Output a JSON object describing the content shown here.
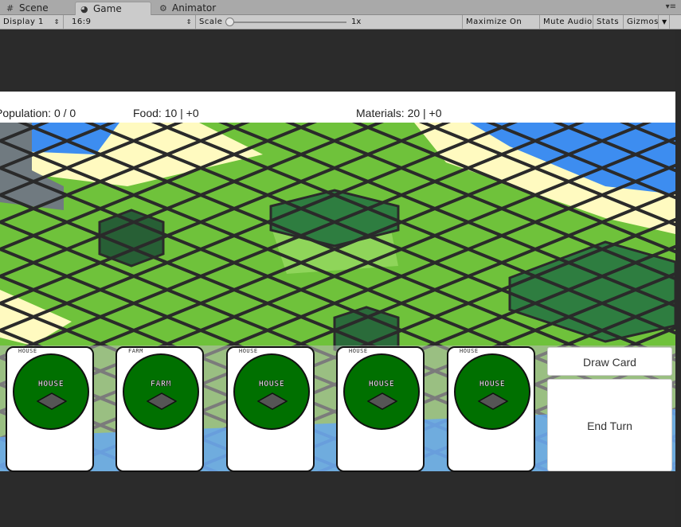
{
  "editor": {
    "tabs": [
      {
        "label": "Scene",
        "icon": "grid-icon"
      },
      {
        "label": "Game",
        "icon": "pacman-icon"
      },
      {
        "label": "Animator",
        "icon": "animator-icon"
      }
    ],
    "toolbar": {
      "display": "Display 1",
      "aspect": "16:9",
      "scale_label": "Scale",
      "scale_value": "1x",
      "maximize": "Maximize On Play",
      "mute": "Mute Audio",
      "stats": "Stats",
      "gizmos": "Gizmos"
    }
  },
  "hud": {
    "population": "Population: 0 / 0",
    "food": "Food: 10 | +0",
    "materials": "Materials: 20 | +0"
  },
  "hand": [
    {
      "top_label": "HOUSE",
      "title": "HOUSE"
    },
    {
      "top_label": "FARM",
      "title": "FARM"
    },
    {
      "top_label": "HOUSE",
      "title": "HOUSE"
    },
    {
      "top_label": "HOUSE",
      "title": "HOUSE"
    },
    {
      "top_label": "HOUSE",
      "title": "HOUSE"
    }
  ],
  "buttons": {
    "draw": "Draw Card",
    "end_turn": "End Turn"
  },
  "colors": {
    "grass": "#6fc23b",
    "forest": "#2e7d40",
    "sand": "#fffac0",
    "water": "#3d8df0",
    "rock": "#707a80",
    "card_disc": "#007000"
  }
}
